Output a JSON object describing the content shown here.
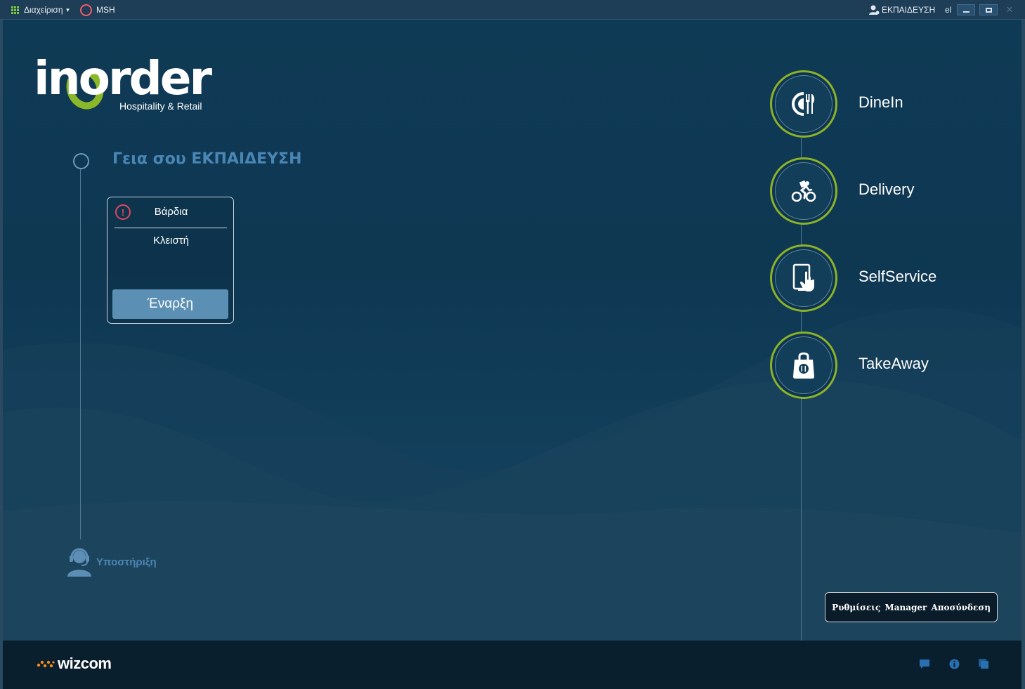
{
  "titlebar": {
    "menu_label": "Διαχείριση",
    "store_label": "MSH",
    "user_label": "ΕΚΠΑΙΔΕΥΣΗ",
    "language": "el"
  },
  "logo": {
    "wordmark": "inorder",
    "tagline": "Hospitality & Retail"
  },
  "greeting": "Γεια σου ΕΚΠΑΙΔΕΥΣΗ",
  "shift": {
    "title": "Βάρδια",
    "status": "Κλειστή",
    "start_label": "Έναρξη"
  },
  "support_label": "Υποστήριξη",
  "services": [
    {
      "label": "DineIn",
      "icon": "dine-in-icon"
    },
    {
      "label": "Delivery",
      "icon": "delivery-bike-icon"
    },
    {
      "label": "SelfService",
      "icon": "self-service-tablet-icon"
    },
    {
      "label": "TakeAway",
      "icon": "takeaway-bag-icon"
    }
  ],
  "bottom_buttons": {
    "settings": "Ρυθμίσεις",
    "manager": "Manager",
    "logout": "Αποσύνδεση"
  },
  "footer": {
    "brand": "wizcom"
  },
  "colors": {
    "accent_green": "#8cb327",
    "heading_blue": "#4a86b4",
    "alert_red": "#e2475e",
    "button_blue": "#5b8fb4"
  }
}
